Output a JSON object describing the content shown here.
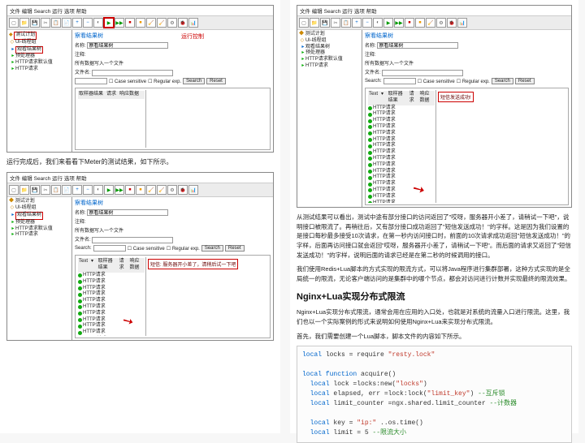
{
  "titlebar": "文件 编辑 Search 运行 选项 帮助",
  "toolbar_icons": [
    "📄",
    "📁",
    "💾",
    "✂",
    "📋",
    "+",
    "−",
    "▶",
    "▶▶",
    "⏹",
    "⏹",
    "🧹",
    "🧹",
    "🔧",
    "🐞",
    "📊",
    "⏱",
    "📍"
  ],
  "run_label": "运行控制",
  "tree": {
    "root": "测试计划",
    "thread_group": "Ul-线程组",
    "config": "预处理器",
    "view_results": "观看结果树",
    "http1": "HTTP请求",
    "http_defaults": "HTTP请求默认值",
    "http2": "HTTP请求"
  },
  "panel": {
    "title": "察看结果树",
    "name_label": "名称:",
    "name_value": "察看结果树",
    "comment_label": "注释:",
    "write_file_label": "所有数据写入一个文件",
    "filename_label": "文件名:",
    "case_sensitive": "Case sensitive",
    "regular_exp": "Regular exp.",
    "search_btn": "Search",
    "reset_btn": "Reset",
    "tabs": [
      "取样器结果",
      "请求",
      "响应数据"
    ]
  },
  "http_item": "HTTP请求",
  "article_left_1": "运行完成后，我们来看看下Meter的测试结果，如下所示。",
  "msg_service_busy": "短信: 服务器开小差了，清稍后试一下吧",
  "sel_marked": "[已选 marked=11]",
  "right_para_1": "从测试结果可以看出，测试中途有部分接口的访问返回了\"哎呀，服务器开小差了，请稍试一下吧\"，说明接口被限流了。再稍往后，又有部分接口成功返回了\"短信发送成功！\"的字样。这是因为我们设置的是接口每秒最多接受10次请求，在第一秒内访问接口时，前面的10次请求成功返回\"短信发送成功！\"的字样，后面再访问接口就会返回\"哎呀，服务器开小差了，请稍试一下吧\"。而后面的请求又返回了\"短信发送成功！\"的字样，说明后面的请求已经是在第二秒的时候调用的接口。",
  "right_para_2": "我们使用Redis+Lua脚本的方式实现的限流方式，可以将Java程序进行集群部署，这种方式实现的是全局统一的限流，无论客户端访问的是集群中的哪个节点，都会对访问进行计数并实现最终的限流效果。",
  "success_msg": "短信发送成功!",
  "h2": "Nginx+Lua实现分布式限流",
  "right_para_3": "Nginx+Lua实现分布式限流，通常会用在应用的入口处，也就是对系统的流量入口进行限流。这里，我们也以一个实际案例的形式来说明如何使用Nginx+Lua来实现分布式限流。",
  "right_para_4": "首先，我们需要创建一个Lua脚本，脚本文件的内容如下所示。",
  "code": {
    "l1a": "local",
    "l1b": " locks = require ",
    "l1c": "\"resty.lock\"",
    "l2a": "local function",
    "l2b": " acquire()",
    "l3a": "  local",
    "l3b": " lock =locks:new(",
    "l3c": "\"locks\"",
    "l3d": ")",
    "l4a": "  local",
    "l4b": " elapsed, err =lock:lock(",
    "l4c": "\"limit_key\"",
    "l4d": ") ",
    "l4e": "--互斥锁",
    "l5a": "  local",
    "l5b": " limit_counter =ngx.shared.limit_counter ",
    "l5c": "--计数器",
    "l6a": "  local",
    "l6b": " key = ",
    "l6c": "\"ip:\"",
    "l6d": " ..os.time()",
    "l7a": "  local",
    "l7b": " limit = 5 ",
    "l7c": "--限流大小"
  }
}
